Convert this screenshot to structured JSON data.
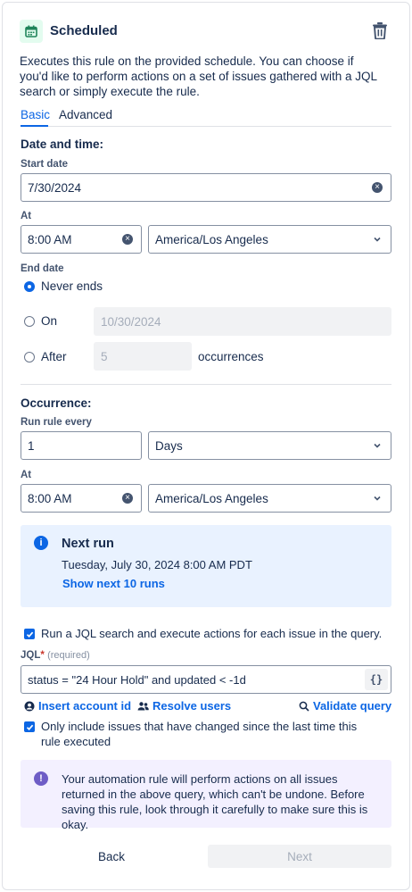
{
  "header": {
    "title": "Scheduled"
  },
  "description": "Executes this rule on the provided schedule. You can choose if you'd like to perform actions on a set of issues gathered with a JQL search or simply execute the rule.",
  "tabs": [
    {
      "label": "Basic",
      "active": true
    },
    {
      "label": "Advanced",
      "active": false
    }
  ],
  "date_time": {
    "heading": "Date and time:",
    "start_date_label": "Start date",
    "start_date_value": "7/30/2024",
    "at_label": "At",
    "time_value": "8:00 AM",
    "timezone_value": "America/Los Angeles",
    "end_date_label": "End date",
    "end_options": [
      {
        "label": "Never ends",
        "selected": true
      },
      {
        "label": "On",
        "selected": false,
        "value": "10/30/2024"
      },
      {
        "label": "After",
        "selected": false,
        "value": "5",
        "suffix": "occurrences"
      }
    ]
  },
  "occurrence": {
    "heading": "Occurrence:",
    "run_every_label": "Run rule every",
    "run_every_value": "1",
    "unit_value": "Days",
    "at_label": "At",
    "time_value": "8:00 AM",
    "timezone_value": "America/Los Angeles"
  },
  "next_run": {
    "title": "Next run",
    "datetime": "Tuesday, July 30, 2024 8:00 AM PDT",
    "link": "Show next 10 runs"
  },
  "jql": {
    "checkbox_label": "Run a JQL search and execute actions for each issue in the query.",
    "checked": true,
    "label": "JQL",
    "required_marker": "*",
    "required_text": "(required)",
    "value": "status = \"24 Hour Hold\" and updated < -1d",
    "braces": "{}",
    "actions": {
      "insert_account": "Insert account id",
      "resolve_users": "Resolve users",
      "validate": "Validate query"
    },
    "only_changed_label": "Only include issues that have changed since the last time this rule executed",
    "only_changed_checked": true
  },
  "warning": "Your automation rule will perform actions on all issues returned in the above query, which can't be undone. Before saving this rule, look through it carefully to make sure this is okay.",
  "footer": {
    "back": "Back",
    "next": "Next"
  },
  "colors": {
    "accent": "#0c66e4",
    "info_bg": "#e9f2ff",
    "warn_bg": "#f3f0ff",
    "warn_icon": "#6e5dc6",
    "trigger_icon": "#1f845a"
  }
}
